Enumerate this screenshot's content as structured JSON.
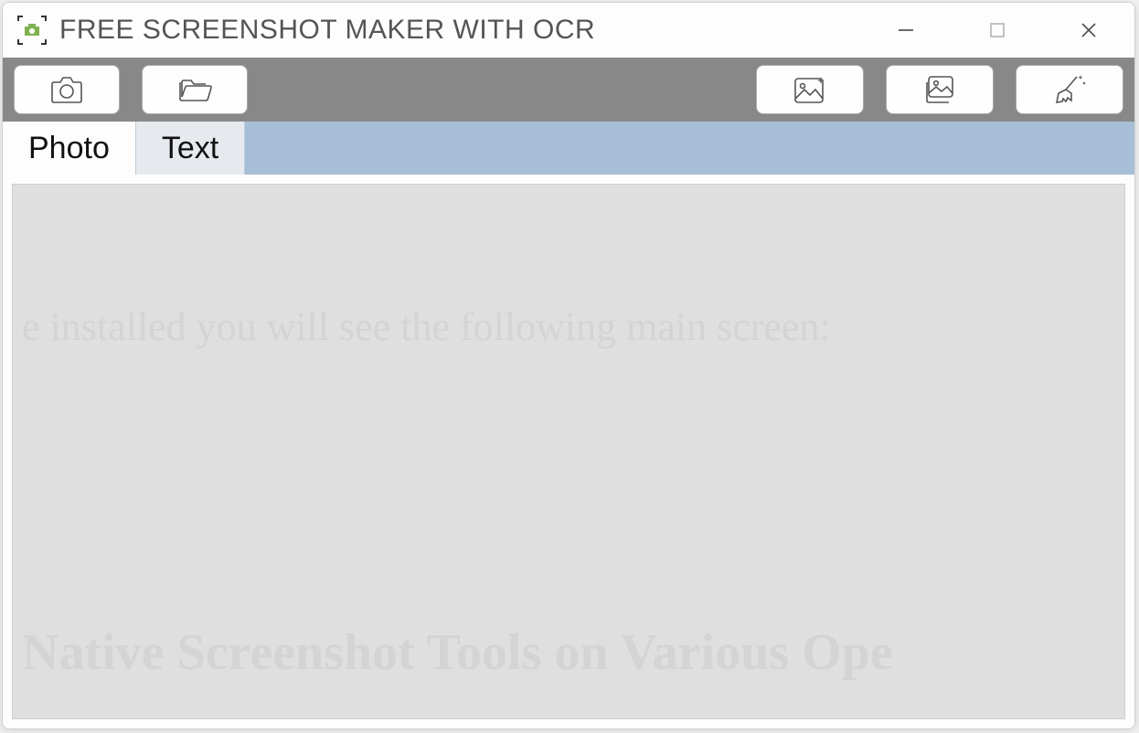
{
  "titlebar": {
    "title": "FREE SCREENSHOT MAKER WITH OCR"
  },
  "tabs": {
    "photo": "Photo",
    "text": "Text"
  },
  "ghost": {
    "line1": "e installed you will see the following main screen:",
    "line2": "Native Screenshot Tools on Various Ope"
  }
}
